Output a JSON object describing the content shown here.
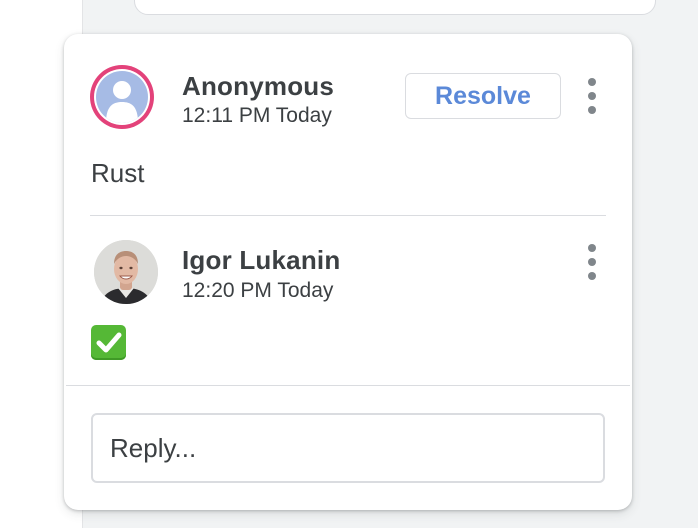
{
  "thread": {
    "comment": {
      "author": "Anonymous",
      "time": "12:11 PM Today",
      "text": "Rust",
      "resolve_label": "Resolve",
      "avatar_ring_color": "#e3427a",
      "avatar_icon": "default-person-avatar"
    },
    "reply": {
      "author": "Igor Lukanin",
      "time": "12:20 PM Today",
      "emoji_icon": "green-check-mark-emoji"
    },
    "reply_box": {
      "placeholder": "Reply..."
    }
  },
  "colors": {
    "accent": "#5b89d8",
    "text": "#3c4043",
    "divider": "#dadce0"
  }
}
